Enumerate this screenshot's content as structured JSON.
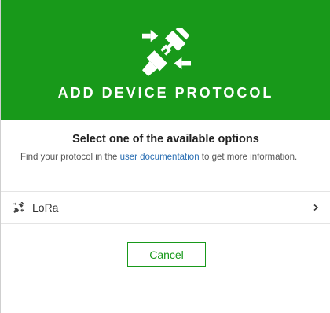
{
  "dialog": {
    "title": "ADD DEVICE PROTOCOL",
    "header_icon": "plug-connect-icon",
    "header_color": "#18991a"
  },
  "prompt": {
    "heading": "Select one of the available options",
    "help_prefix": "Find your protocol in the ",
    "help_link": "user documentation",
    "help_suffix": " to get more information."
  },
  "options": [
    {
      "label": "LoRa",
      "icon": "plug-connect-icon",
      "chevron": "chevron-right-icon"
    }
  ],
  "actions": {
    "cancel_label": "Cancel"
  },
  "colors": {
    "accent": "#18991a",
    "link": "#2b6fb3"
  }
}
